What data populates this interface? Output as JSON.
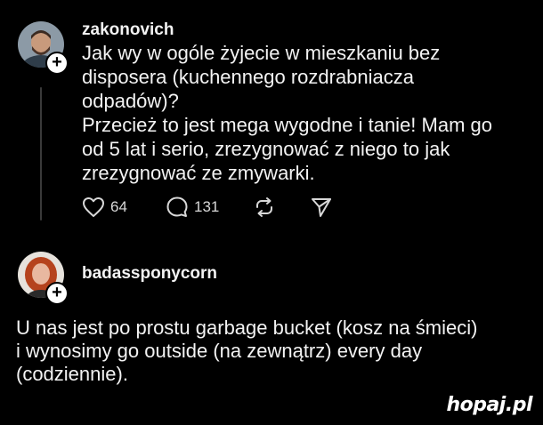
{
  "post1": {
    "username": "zakonovich",
    "avatar_icon": "user-avatar",
    "text": "Jak wy w ogóle żyjecie w mieszkaniu bez\ndisposera (kuchennego rozdrabniacza\nodpadów)?\nPrzecież to jest mega wygodne i tanie! Mam go\nod 5 lat i serio, zrezygnować z niego to jak\nzrezygnować ze zmywarki.",
    "likes": "64",
    "comments": "131"
  },
  "post2": {
    "username": "badassponycorn",
    "avatar_icon": "user-avatar",
    "text": "U nas jest po prostu garbage bucket (kosz na śmieci)\ni wynosimy go outside (na zewnątrz) every day\n(codziennie)."
  },
  "follow_label": "+",
  "watermark": "hopaj.pl",
  "colors": {
    "background": "#000000",
    "text": "#f3f3f3",
    "icon": "#d8d8d8"
  }
}
